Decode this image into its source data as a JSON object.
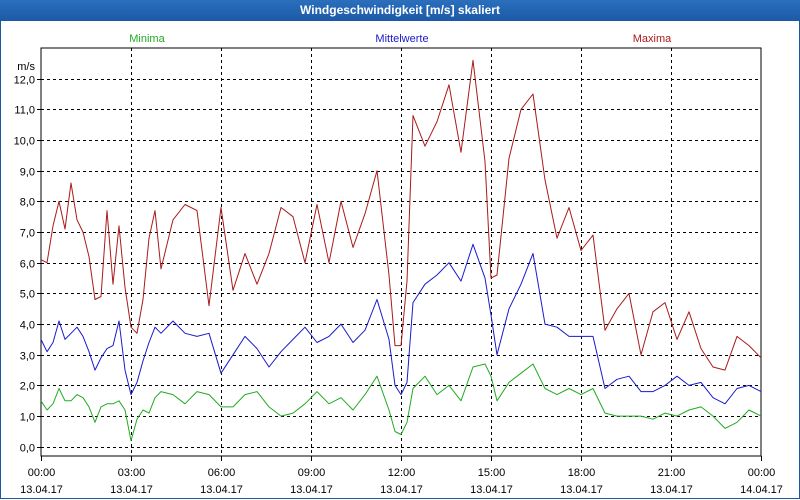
{
  "window": {
    "title": "Windgeschwindigkeit [m/s] skaliert"
  },
  "chart_data": {
    "type": "line",
    "title": "Windgeschwindigkeit [m/s] skaliert",
    "ylabel": "m/s",
    "xlabel": "",
    "ylim": [
      -0.3,
      13.0
    ],
    "yticks": [
      0.0,
      1.0,
      2.0,
      3.0,
      4.0,
      5.0,
      6.0,
      7.0,
      8.0,
      9.0,
      10.0,
      11.0,
      12.0
    ],
    "ytick_labels": [
      "0,0",
      "1,0",
      "2,0",
      "3,0",
      "4,0",
      "5,0",
      "6,0",
      "7,0",
      "8,0",
      "9,0",
      "10,0",
      "11,0",
      "12,0"
    ],
    "xticks": [
      {
        "time": "00:00",
        "date": "13.04.17"
      },
      {
        "time": "03:00",
        "date": "13.04.17"
      },
      {
        "time": "06:00",
        "date": "13.04.17"
      },
      {
        "time": "09:00",
        "date": "13.04.17"
      },
      {
        "time": "12:00",
        "date": "13.04.17"
      },
      {
        "time": "15:00",
        "date": "13.04.17"
      },
      {
        "time": "18:00",
        "date": "13.04.17"
      },
      {
        "time": "21:00",
        "date": "13.04.17"
      },
      {
        "time": "00:00",
        "date": "14.04.17"
      }
    ],
    "x_range_hours": [
      0,
      24
    ],
    "grid": true,
    "series": [
      {
        "name": "Minima",
        "color": "#22aa22",
        "legend_position": "left",
        "x_hours": [
          0.0,
          0.2,
          0.4,
          0.6,
          0.8,
          1.0,
          1.2,
          1.4,
          1.6,
          1.8,
          2.0,
          2.2,
          2.4,
          2.6,
          2.8,
          3.0,
          3.2,
          3.4,
          3.6,
          3.8,
          4.0,
          4.4,
          4.8,
          5.2,
          5.6,
          6.0,
          6.4,
          6.8,
          7.2,
          7.6,
          8.0,
          8.4,
          8.8,
          9.2,
          9.6,
          10.0,
          10.4,
          10.8,
          11.2,
          11.6,
          11.8,
          12.0,
          12.2,
          12.4,
          12.8,
          13.2,
          13.6,
          14.0,
          14.4,
          14.8,
          15.0,
          15.2,
          15.6,
          16.0,
          16.4,
          16.8,
          17.2,
          17.6,
          18.0,
          18.4,
          18.8,
          19.2,
          19.6,
          20.0,
          20.4,
          20.8,
          21.2,
          21.6,
          22.0,
          22.4,
          22.8,
          23.2,
          23.6,
          24.0
        ],
        "values": [
          1.5,
          1.2,
          1.4,
          1.9,
          1.5,
          1.5,
          1.7,
          1.6,
          1.3,
          0.8,
          1.3,
          1.4,
          1.4,
          1.5,
          1.2,
          0.2,
          0.9,
          1.2,
          1.1,
          1.6,
          1.8,
          1.7,
          1.4,
          1.8,
          1.7,
          1.3,
          1.3,
          1.7,
          1.8,
          1.3,
          1.0,
          1.1,
          1.4,
          1.8,
          1.4,
          1.6,
          1.2,
          1.7,
          2.3,
          1.2,
          0.5,
          0.4,
          0.8,
          1.9,
          2.3,
          1.7,
          2.0,
          1.5,
          2.6,
          2.7,
          2.3,
          1.5,
          2.1,
          2.4,
          2.7,
          1.9,
          1.7,
          1.9,
          1.7,
          1.9,
          1.1,
          1.0,
          1.0,
          1.0,
          0.9,
          1.1,
          1.0,
          1.2,
          1.3,
          1.0,
          0.6,
          0.8,
          1.2,
          1.0
        ]
      },
      {
        "name": "Mittelwerte",
        "color": "#1a1acc",
        "legend_position": "center",
        "x_hours": [
          0.0,
          0.2,
          0.4,
          0.6,
          0.8,
          1.0,
          1.2,
          1.4,
          1.6,
          1.8,
          2.0,
          2.2,
          2.4,
          2.6,
          2.8,
          3.0,
          3.2,
          3.4,
          3.6,
          3.8,
          4.0,
          4.4,
          4.8,
          5.2,
          5.6,
          6.0,
          6.4,
          6.8,
          7.2,
          7.6,
          8.0,
          8.4,
          8.8,
          9.2,
          9.6,
          10.0,
          10.4,
          10.8,
          11.2,
          11.6,
          11.8,
          12.0,
          12.2,
          12.4,
          12.8,
          13.2,
          13.6,
          14.0,
          14.4,
          14.8,
          15.0,
          15.2,
          15.6,
          16.0,
          16.4,
          16.8,
          17.2,
          17.6,
          18.0,
          18.4,
          18.8,
          19.2,
          19.6,
          20.0,
          20.4,
          20.8,
          21.2,
          21.6,
          22.0,
          22.4,
          22.8,
          23.2,
          23.6,
          24.0
        ],
        "values": [
          3.5,
          3.1,
          3.4,
          4.1,
          3.5,
          3.7,
          3.9,
          3.6,
          3.1,
          2.5,
          2.9,
          3.2,
          3.3,
          4.1,
          2.5,
          1.7,
          2.1,
          2.8,
          3.4,
          3.9,
          3.7,
          4.1,
          3.7,
          3.6,
          3.7,
          2.4,
          3.0,
          3.6,
          3.2,
          2.6,
          3.1,
          3.5,
          3.9,
          3.4,
          3.6,
          4.0,
          3.4,
          3.8,
          4.8,
          3.5,
          2.0,
          1.7,
          2.1,
          4.7,
          5.3,
          5.6,
          6.0,
          5.4,
          6.6,
          5.5,
          4.3,
          3.0,
          4.5,
          5.3,
          6.3,
          4.0,
          3.9,
          3.6,
          3.6,
          3.6,
          1.9,
          2.2,
          2.3,
          1.8,
          1.8,
          2.0,
          2.3,
          2.0,
          2.1,
          1.6,
          1.4,
          1.9,
          2.0,
          1.8
        ]
      },
      {
        "name": "Maxima",
        "color": "#aa1a1a",
        "legend_position": "right",
        "x_hours": [
          0.0,
          0.2,
          0.4,
          0.6,
          0.8,
          1.0,
          1.2,
          1.4,
          1.6,
          1.8,
          2.0,
          2.2,
          2.4,
          2.6,
          2.8,
          3.0,
          3.2,
          3.4,
          3.6,
          3.8,
          4.0,
          4.4,
          4.8,
          5.2,
          5.6,
          6.0,
          6.4,
          6.8,
          7.2,
          7.6,
          8.0,
          8.4,
          8.8,
          9.2,
          9.6,
          10.0,
          10.4,
          10.8,
          11.2,
          11.6,
          11.8,
          12.0,
          12.2,
          12.4,
          12.8,
          13.2,
          13.6,
          14.0,
          14.4,
          14.8,
          15.0,
          15.2,
          15.6,
          16.0,
          16.4,
          16.8,
          17.2,
          17.6,
          18.0,
          18.4,
          18.8,
          19.2,
          19.6,
          20.0,
          20.4,
          20.8,
          21.2,
          21.6,
          22.0,
          22.4,
          22.8,
          23.2,
          23.6,
          24.0
        ],
        "values": [
          6.1,
          6.0,
          7.2,
          8.0,
          7.1,
          8.6,
          7.4,
          7.0,
          6.2,
          4.8,
          4.9,
          7.7,
          5.3,
          7.2,
          5.2,
          3.9,
          3.7,
          4.8,
          6.8,
          7.7,
          5.8,
          7.4,
          7.9,
          7.7,
          4.6,
          7.8,
          5.1,
          6.3,
          5.3,
          6.3,
          7.8,
          7.5,
          6.0,
          7.9,
          6.0,
          8.0,
          6.5,
          7.6,
          9.0,
          5.6,
          3.3,
          3.3,
          5.4,
          10.8,
          9.8,
          10.6,
          11.8,
          9.6,
          12.6,
          9.3,
          5.5,
          5.6,
          9.4,
          11.0,
          11.5,
          8.7,
          6.8,
          7.8,
          6.4,
          6.9,
          3.8,
          4.5,
          5.0,
          3.0,
          4.4,
          4.7,
          3.5,
          4.4,
          3.2,
          2.6,
          2.5,
          3.6,
          3.3,
          2.9
        ]
      }
    ]
  }
}
